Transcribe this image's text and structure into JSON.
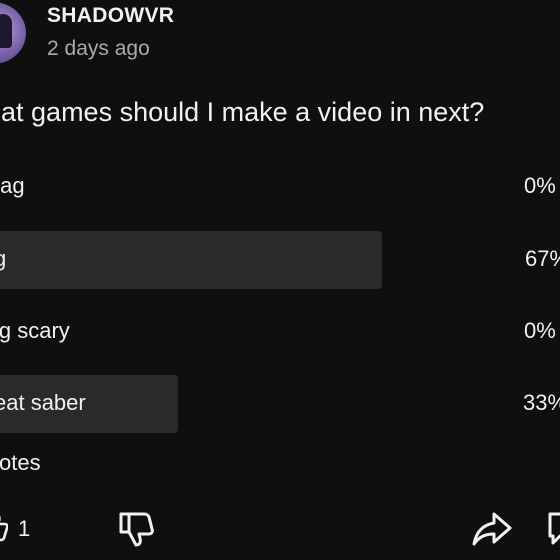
{
  "channel": {
    "name": "SHADOWVR",
    "posted": "2 days ago"
  },
  "poll": {
    "question": "hat games should I make a video in next?",
    "options": [
      {
        "label": "tag",
        "percent": "0%",
        "share": 0
      },
      {
        "label": "g",
        "percent": "67%",
        "share": 67
      },
      {
        "label": "ig scary",
        "percent": "0%",
        "share": 0
      },
      {
        "label": "eat saber",
        "percent": "33%",
        "share": 33
      }
    ],
    "votes": "votes"
  },
  "actions": {
    "like_count": "1",
    "icons": [
      "thumbs-up-icon",
      "thumbs-down-icon",
      "share-icon",
      "comment-icon"
    ]
  },
  "colors": {
    "background": "#0f0f0f",
    "bar": "#2a2a2a",
    "text": "#f1f1f1",
    "secondary_text": "#aaaaaa",
    "avatar_accent": "#7b63ad"
  }
}
